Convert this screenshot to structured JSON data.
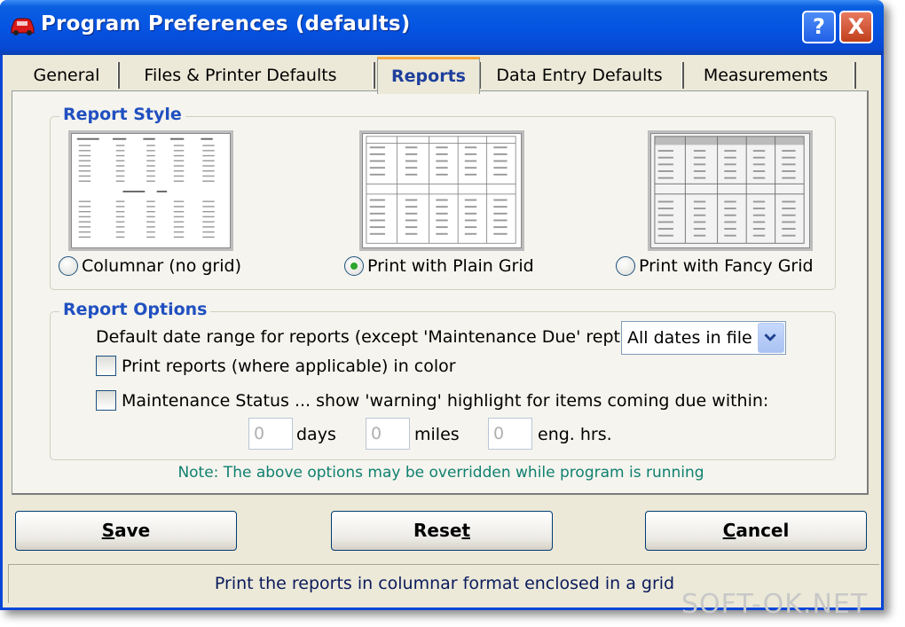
{
  "window": {
    "title": "Program Preferences (defaults)",
    "help_button": "?",
    "close_button": "X"
  },
  "tabs": [
    {
      "label": "General"
    },
    {
      "label": "Files & Printer Defaults"
    },
    {
      "label": "Reports",
      "active": true
    },
    {
      "label": "Data Entry Defaults"
    },
    {
      "label": "Measurements"
    }
  ],
  "report_style": {
    "title": "Report Style",
    "options": [
      {
        "label": "Columnar (no grid)",
        "checked": false
      },
      {
        "label": "Print with Plain Grid",
        "checked": true
      },
      {
        "label": "Print with Fancy Grid",
        "checked": false
      }
    ]
  },
  "report_options": {
    "title": "Report Options",
    "date_range_label": "Default date range for reports (except 'Maintenance Due' rept):",
    "date_range_value": "All dates in file",
    "color_label": "Print reports (where applicable) in color",
    "color_checked": false,
    "warning_label": "Maintenance Status ... show 'warning' highlight for items coming due within:",
    "warning_checked": false,
    "days_value": "0",
    "days_label": "days",
    "miles_value": "0",
    "miles_label": "miles",
    "hours_value": "0",
    "hours_label": "eng. hrs."
  },
  "note": "Note: The above options may be overridden while program is running",
  "buttons": {
    "save_first": "S",
    "save_rest": "ave",
    "reset_first": "Rese",
    "reset_rest": "t",
    "cancel_first": "C",
    "cancel_rest": "ancel"
  },
  "status": "Print the reports in columnar format enclosed in a grid",
  "watermark": "SOFT-OK.NET",
  "colors": {
    "title_bar": "#0554e3",
    "group_title": "#2050c0",
    "note": "#108070",
    "active_tab_accent": "#f6a83c"
  }
}
